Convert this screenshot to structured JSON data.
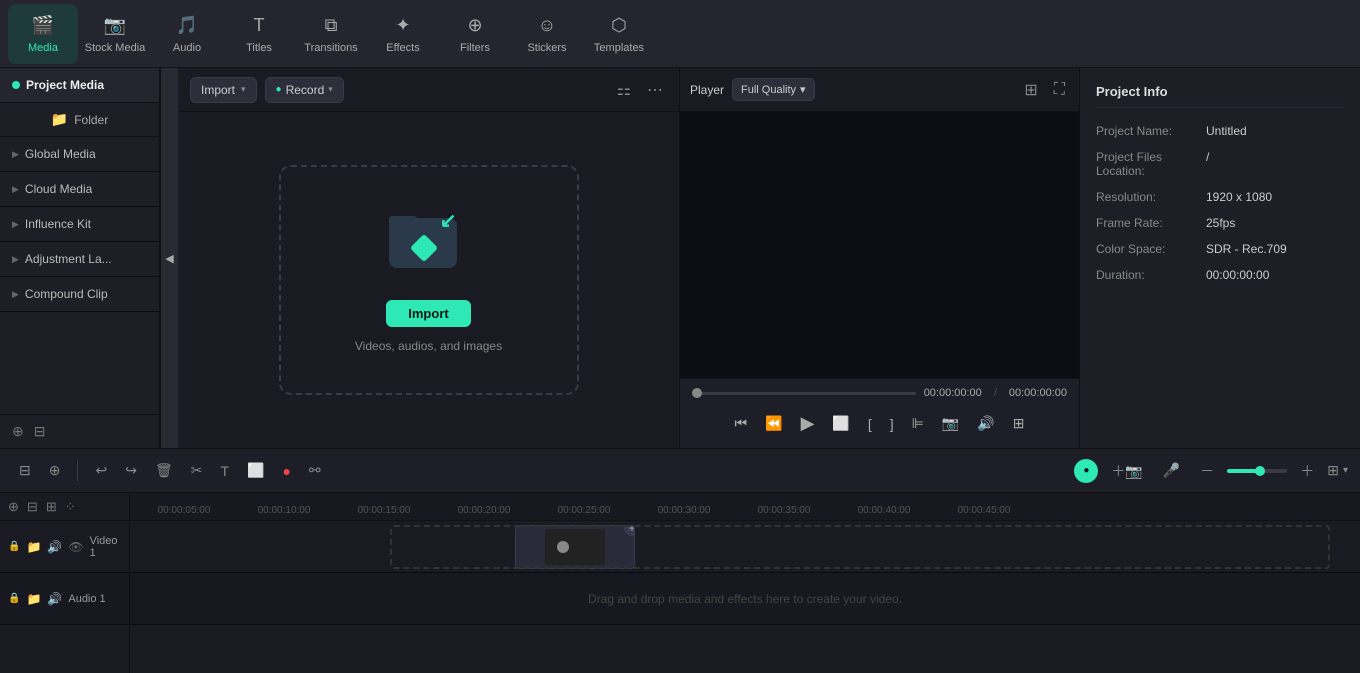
{
  "toolbar": {
    "items": [
      {
        "id": "media",
        "label": "Media",
        "icon": "🎬",
        "active": true
      },
      {
        "id": "stock-media",
        "label": "Stock Media",
        "icon": "📷"
      },
      {
        "id": "audio",
        "label": "Audio",
        "icon": "🎵"
      },
      {
        "id": "titles",
        "label": "Titles",
        "icon": "T"
      },
      {
        "id": "transitions",
        "label": "Transitions",
        "icon": "⧉"
      },
      {
        "id": "effects",
        "label": "Effects",
        "icon": "✦"
      },
      {
        "id": "filters",
        "label": "Filters",
        "icon": "⊕"
      },
      {
        "id": "stickers",
        "label": "Stickers",
        "icon": "☺"
      },
      {
        "id": "templates",
        "label": "Templates",
        "icon": "⬡"
      }
    ]
  },
  "sidebar": {
    "project_media_label": "Project Media",
    "folder_label": "Folder",
    "items": [
      {
        "id": "global-media",
        "label": "Global Media"
      },
      {
        "id": "cloud-media",
        "label": "Cloud Media"
      },
      {
        "id": "influence-kit",
        "label": "Influence Kit"
      },
      {
        "id": "adjustment-la",
        "label": "Adjustment La..."
      },
      {
        "id": "compound-clip",
        "label": "Compound Clip"
      }
    ]
  },
  "media_panel": {
    "import_label": "Import",
    "import_arrow": "▾",
    "record_label": "Record",
    "record_arrow": "▾",
    "drop_instruction": "Videos, audios, and images"
  },
  "player": {
    "label": "Player",
    "quality": "Full Quality",
    "quality_arrow": "▾",
    "current_time": "00:00:00:00",
    "total_time": "00:00:00:00",
    "separator": "/"
  },
  "project_info": {
    "title": "Project Info",
    "fields": [
      {
        "label": "Project Name:",
        "value": "Untitled"
      },
      {
        "label": "Project Files Location:",
        "value": "/"
      },
      {
        "label": "Resolution:",
        "value": "1920 x 1080"
      },
      {
        "label": "Frame Rate:",
        "value": "25fps"
      },
      {
        "label": "Color Space:",
        "value": "SDR - Rec.709"
      },
      {
        "label": "Duration:",
        "value": "00:00:00:00"
      }
    ]
  },
  "timeline": {
    "ruler_marks": [
      "00:00:05:00",
      "00:00:10:00",
      "00:00:15:00",
      "00:00:20:00",
      "00:00:25:00",
      "00:00:30:00",
      "00:00:35:00",
      "00:00:40:00",
      "00:00:45:00"
    ],
    "video_track_label": "Video 1",
    "audio_track_label": "Audio 1",
    "drop_hint": "Drag and drop media and effects here to create your video."
  },
  "colors": {
    "accent": "#2ee8b5",
    "bg_dark": "#1a1a22",
    "bg_panel": "#1e1e26"
  }
}
